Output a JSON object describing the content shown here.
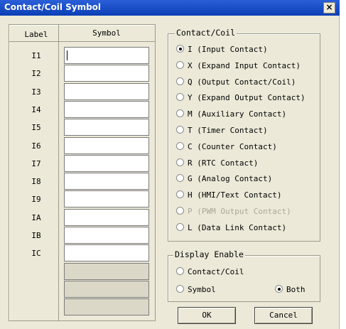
{
  "window": {
    "title": "Contact/Coil Symbol",
    "close_glyph": "×"
  },
  "table": {
    "label_header": "Label",
    "symbol_header": "Symbol",
    "rows": [
      {
        "label": "I1",
        "value": ""
      },
      {
        "label": "I2",
        "value": ""
      },
      {
        "label": "I3",
        "value": ""
      },
      {
        "label": "I4",
        "value": ""
      },
      {
        "label": "I5",
        "value": ""
      },
      {
        "label": "I6",
        "value": ""
      },
      {
        "label": "I7",
        "value": ""
      },
      {
        "label": "I8",
        "value": ""
      },
      {
        "label": "I9",
        "value": ""
      },
      {
        "label": "IA",
        "value": ""
      },
      {
        "label": "IB",
        "value": ""
      },
      {
        "label": "IC",
        "value": ""
      }
    ],
    "disabled_rows": 3
  },
  "contact_coil": {
    "group_label": "Contact/Coil",
    "selected": 0,
    "options": [
      {
        "label": "I (Input Contact)",
        "enabled": true
      },
      {
        "label": "X (Expand Input Contact)",
        "enabled": true
      },
      {
        "label": "Q (Output Contact/Coil)",
        "enabled": true
      },
      {
        "label": "Y (Expand Output Contact)",
        "enabled": true
      },
      {
        "label": "M (Auxiliary Contact)",
        "enabled": true
      },
      {
        "label": "T (Timer Contact)",
        "enabled": true
      },
      {
        "label": "C (Counter Contact)",
        "enabled": true
      },
      {
        "label": "R (RTC Contact)",
        "enabled": true
      },
      {
        "label": "G (Analog Contact)",
        "enabled": true
      },
      {
        "label": "H (HMI/Text Contact)",
        "enabled": true
      },
      {
        "label": "P (PWM Output Contact)",
        "enabled": false
      },
      {
        "label": "L (Data Link Contact)",
        "enabled": true
      }
    ]
  },
  "display_enable": {
    "group_label": "Display Enable",
    "contact_coil_label": "Contact/Coil",
    "symbol_label": "Symbol",
    "both_label": "Both",
    "selected": "both"
  },
  "buttons": {
    "ok_label": "OK",
    "cancel_label": "Cancel"
  },
  "colors": {
    "title_bar": "#0a3fb5",
    "dialog_bg": "#ece9d8",
    "disabled_text": "#aca899"
  }
}
